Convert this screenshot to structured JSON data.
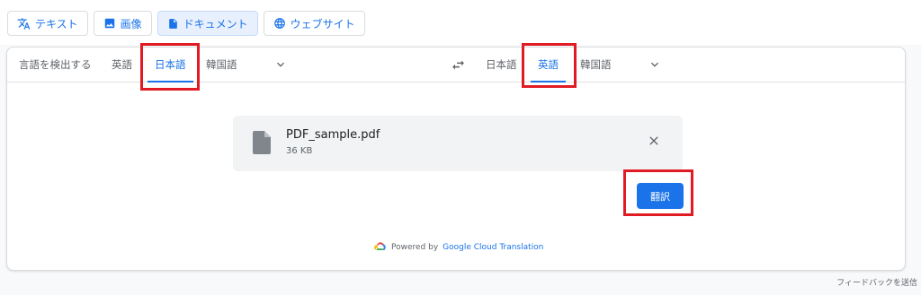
{
  "modes": [
    {
      "label": "テキスト",
      "icon": "translate-icon"
    },
    {
      "label": "画像",
      "icon": "image-icon"
    },
    {
      "label": "ドキュメント",
      "icon": "document-icon",
      "active": true
    },
    {
      "label": "ウェブサイト",
      "icon": "globe-icon"
    }
  ],
  "source_langs": {
    "detect": "言語を検出する",
    "english": "英語",
    "japanese": "日本語",
    "korean": "韓国語",
    "selected": "日本語"
  },
  "target_langs": {
    "japanese": "日本語",
    "english": "英語",
    "korean": "韓国語",
    "selected": "英語"
  },
  "file": {
    "name": "PDF_sample.pdf",
    "size": "36 KB"
  },
  "translate_button": "翻訳",
  "powered": {
    "prefix": "Powered by",
    "link": "Google Cloud Translation"
  },
  "feedback": "フィードバックを送信",
  "colors": {
    "accent": "#1a73e8",
    "highlight": "#e01b24",
    "file_bg": "#f1f3f4"
  }
}
